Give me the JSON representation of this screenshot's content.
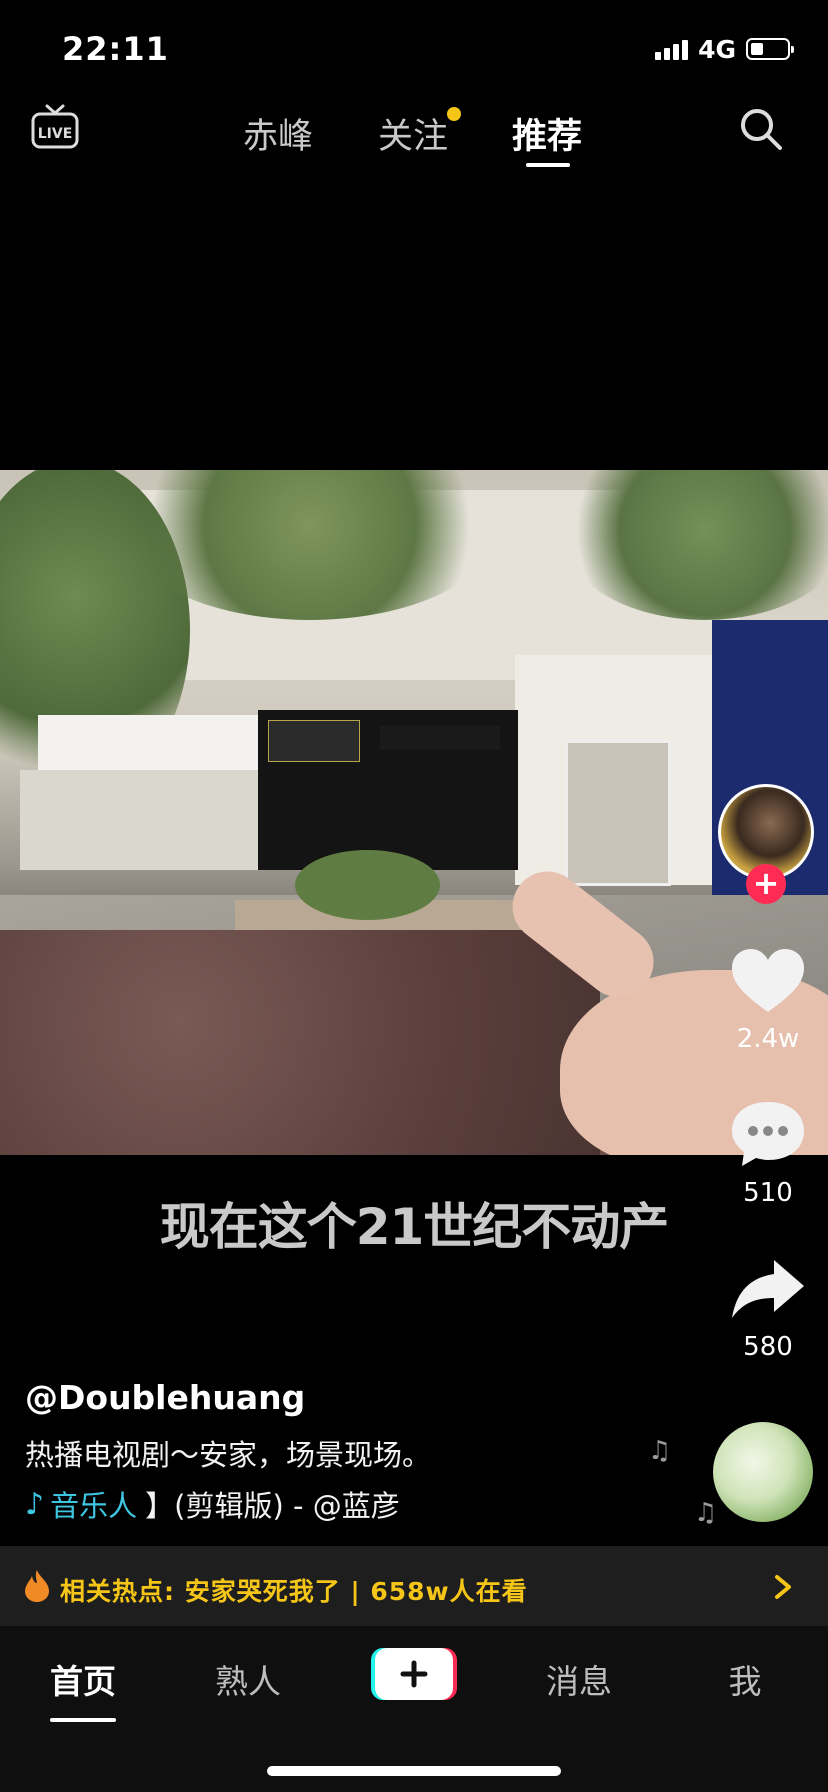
{
  "status_bar": {
    "time": "22:11",
    "network": "4G"
  },
  "top_nav": {
    "tabs": [
      {
        "label": "赤峰",
        "active": false
      },
      {
        "label": "关注",
        "active": false,
        "has_dot": true
      },
      {
        "label": "推荐",
        "active": true
      }
    ],
    "live_icon": "live-tv-icon",
    "search_icon": "search-icon",
    "dot_color": "#f5c518"
  },
  "video": {
    "subtitle": "现在这个21世纪不动产"
  },
  "right_rail": {
    "avatar": "creator-avatar",
    "follow_icon": "plus-icon",
    "like_count": "2.4w",
    "comment_count": "510",
    "share_count": "580",
    "follow_color": "#fe2c55"
  },
  "caption": {
    "username": "@Doublehuang",
    "description": "热播电视剧～安家，场景现场。",
    "music_label": "音乐人",
    "music_text": "】(剪辑版) - @蓝彦"
  },
  "hot_topic": {
    "prefix": "相关热点:",
    "topic": "安家哭死我了",
    "separator": "|",
    "viewers": "658w人在看",
    "accent_color": "#f5c518"
  },
  "bottom_nav": {
    "items": [
      {
        "label": "首页",
        "active": true
      },
      {
        "label": "熟人",
        "active": false
      },
      {
        "label": "消息",
        "active": false
      },
      {
        "label": "我",
        "active": false
      }
    ],
    "create_icon": "plus-icon"
  }
}
